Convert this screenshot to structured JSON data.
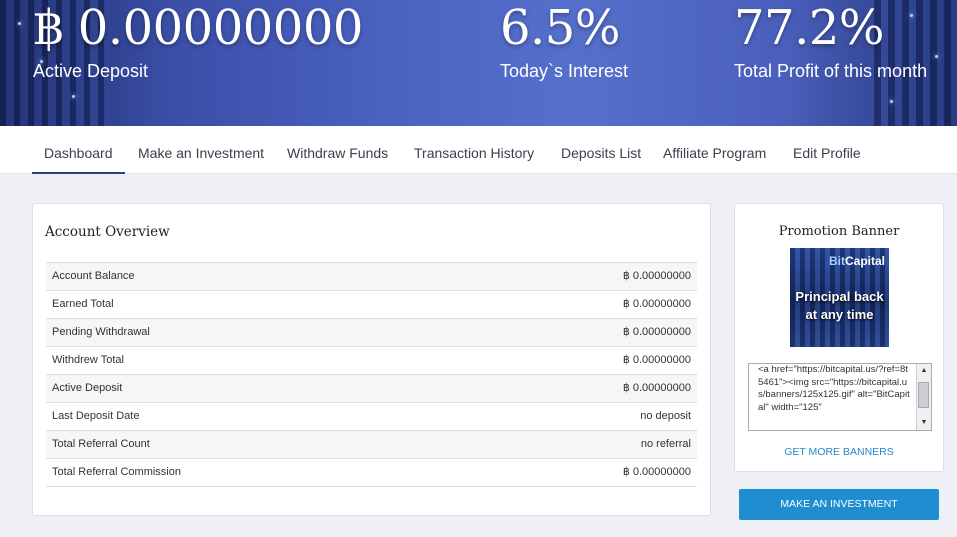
{
  "hero": {
    "deposit_value": "฿ 0.00000000",
    "deposit_label": "Active Deposit",
    "interest_value": "6.5%",
    "interest_label": "Today`s Interest",
    "profit_value": "77.2%",
    "profit_label": "Total Profit of this month"
  },
  "nav": {
    "tabs": [
      "Dashboard",
      "Make an Investment",
      "Withdraw Funds",
      "Transaction History",
      "Deposits List",
      "Affiliate Program",
      "Edit Profile"
    ],
    "active": "Dashboard"
  },
  "overview": {
    "title": "Account Overview",
    "rows": [
      {
        "label": "Account Balance",
        "value": "฿ 0.00000000"
      },
      {
        "label": "Earned Total",
        "value": "฿ 0.00000000"
      },
      {
        "label": "Pending Withdrawal",
        "value": "฿ 0.00000000"
      },
      {
        "label": "Withdrew Total",
        "value": "฿ 0.00000000"
      },
      {
        "label": "Active Deposit",
        "value": "฿ 0.00000000"
      },
      {
        "label": "Last Deposit Date",
        "value": "no deposit"
      },
      {
        "label": "Total Referral Count",
        "value": "no referral"
      },
      {
        "label": "Total Referral Commission",
        "value": "฿ 0.00000000"
      }
    ]
  },
  "promo": {
    "title": "Promotion Banner",
    "banner_brand_a": "Bit",
    "banner_brand_b": "Capital",
    "banner_text": "Principal back at any time",
    "code": "<a href=\"https://bitcapital.us/?ref=8t5461\"><img src=\"https://bitcapital.us/banners/125x125.gif\" alt=\"BitCapital\" width=\"125\"",
    "more_link": "GET MORE BANNERS"
  },
  "invest_button": "MAKE AN INVESTMENT",
  "colors": {
    "accent": "#1e8ed0",
    "link": "#2a88c8",
    "nav_active_underline": "#2b3f7a"
  }
}
